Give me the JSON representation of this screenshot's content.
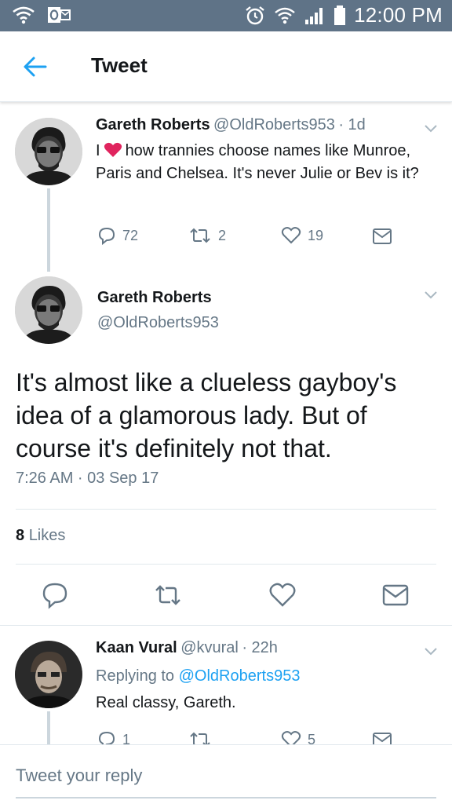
{
  "status_bar": {
    "time": "12:00 PM",
    "left_icons": [
      "wifi-call-icon",
      "outlook-icon"
    ],
    "right_icons": [
      "alarm-icon",
      "wifi-icon",
      "signal-icon",
      "battery-icon"
    ]
  },
  "header": {
    "title": "Tweet",
    "back_icon": "back-arrow-icon"
  },
  "parent_tweet": {
    "name": "Gareth Roberts",
    "handle": "@OldRoberts953",
    "age": "· 1d",
    "text_prefix": "I",
    "text_after_heart": "how trannies choose names like Munroe, Paris and Chelsea. It's never Julie or Bev is it?",
    "replies": "72",
    "retweets": "2",
    "likes": "19"
  },
  "main_tweet": {
    "name": "Gareth Roberts",
    "handle": "@OldRoberts953",
    "text": "It's almost like a clueless gayboy's idea of a glamorous lady. But of course it's definitely not that.",
    "timestamp": "7:26 AM · 03 Sep 17",
    "likes_count": "8",
    "likes_label": "Likes"
  },
  "reply_tweet": {
    "name": "Kaan Vural",
    "handle": "@kvural",
    "age": "· 22h",
    "replying_prefix": "Replying to",
    "replying_to": "@OldRoberts953",
    "text": "Real classy, Gareth.",
    "replies": "1",
    "likes": "5"
  },
  "reply_box": {
    "placeholder": "Tweet your reply"
  },
  "colors": {
    "status_bar": "#5f7387",
    "accent": "#1da1f2",
    "heart": "#e0245e",
    "secondary_text": "#657786"
  }
}
